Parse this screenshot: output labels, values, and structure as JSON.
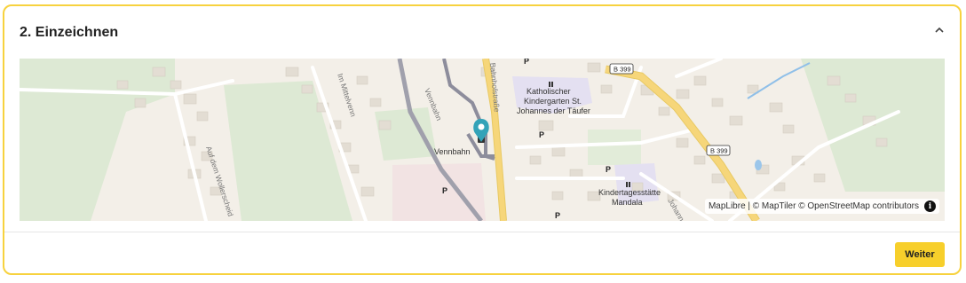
{
  "step": {
    "title": "2. Einzeichnen"
  },
  "icons": {
    "collapse": "chevron-up-icon",
    "marker": "map-marker-icon",
    "info": "info-icon"
  },
  "map": {
    "labels": {
      "vennbahn_track": "Vennbahn",
      "vennbahn_station": "Vennbahn",
      "bahnhofstrasse": "Bahnhofstraße",
      "im_mittelvenn": "Im Mittelvenn",
      "auf_dem_wollerscheid": "Auf dem Wollerscheid",
      "johann": "Johann",
      "kiga1_line1": "Katholischer",
      "kiga1_line2": "Kindergarten St.",
      "kiga1_line3": "Johannes der Täufer",
      "kiga2_line1": "Kindertagesstätte",
      "kiga2_line2": "Mandala",
      "b399_a": "B 399",
      "b399_b": "B 399",
      "parking": "P"
    },
    "attribution": "MapLibre | © MapTiler © OpenStreetMap contributors",
    "attribution_info": "i"
  },
  "actions": {
    "next_label": "Weiter"
  },
  "colors": {
    "accent": "#f7cf2b",
    "border": "#f7d23e",
    "marker": "#33a3b8",
    "road_major": "#f6d67a"
  }
}
